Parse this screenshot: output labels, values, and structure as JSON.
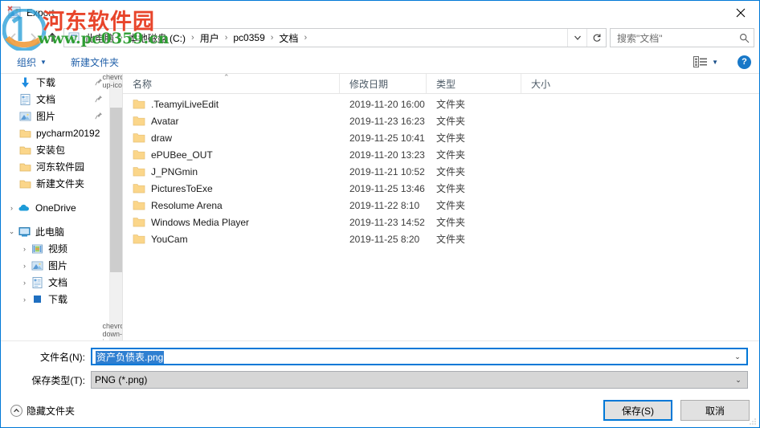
{
  "window": {
    "title": "Export",
    "title_icon": "export-image-icon",
    "close_label": "✕"
  },
  "navigation": {
    "back_icon": "arrow-left-icon",
    "forward_icon": "arrow-right-icon",
    "up_icon": "arrow-up-icon",
    "refresh_icon": "refresh-icon",
    "dropdown_icon": "chevron-down-icon",
    "breadcrumb": [
      {
        "label": "此电脑",
        "icon": "this-pc-icon"
      },
      {
        "label": "本地磁盘 (C:)",
        "icon": ""
      },
      {
        "label": "用户",
        "icon": ""
      },
      {
        "label": "pc0359",
        "icon": ""
      },
      {
        "label": "文档",
        "icon": ""
      }
    ],
    "separator": "›"
  },
  "search": {
    "placeholder": "搜索\"文档\"",
    "icon": "search-icon"
  },
  "toolbar": {
    "organize_label": "组织",
    "organize_caret": "▼",
    "new_folder_label": "新建文件夹",
    "view_icon": "view-layout-icon",
    "view_caret": "▼",
    "help_label": "?",
    "help_icon": "help-icon"
  },
  "sidebar": {
    "items": [
      {
        "label": "下载",
        "icon": "download-icon",
        "indent": 1,
        "expander": "",
        "pinned": true
      },
      {
        "label": "文档",
        "icon": "documents-icon",
        "indent": 1,
        "expander": "",
        "pinned": true
      },
      {
        "label": "图片",
        "icon": "pictures-icon",
        "indent": 1,
        "expander": "",
        "pinned": true
      },
      {
        "label": "pycharm20192",
        "icon": "folder-icon",
        "indent": 1,
        "expander": "",
        "pinned": false
      },
      {
        "label": "安装包",
        "icon": "folder-icon",
        "indent": 1,
        "expander": "",
        "pinned": false
      },
      {
        "label": "河东软件园",
        "icon": "folder-icon",
        "indent": 1,
        "expander": "",
        "pinned": false
      },
      {
        "label": "新建文件夹",
        "icon": "folder-icon",
        "indent": 1,
        "expander": "",
        "pinned": false
      },
      {
        "label": "OneDrive",
        "icon": "onedrive-icon",
        "indent": 1,
        "expander": "›",
        "pinned": false,
        "gap_before": true
      },
      {
        "label": "此电脑",
        "icon": "this-pc-icon",
        "indent": 1,
        "expander": "⌄",
        "pinned": false,
        "gap_before": true
      },
      {
        "label": "视频",
        "icon": "videos-icon",
        "indent": 2,
        "expander": "›",
        "pinned": false
      },
      {
        "label": "图片",
        "icon": "pictures-icon",
        "indent": 2,
        "expander": "›",
        "pinned": false
      },
      {
        "label": "文档",
        "icon": "documents-icon",
        "indent": 2,
        "expander": "›",
        "pinned": false
      },
      {
        "label": "下载",
        "icon": "download-blue-icon",
        "indent": 2,
        "expander": "›",
        "pinned": false
      }
    ],
    "scroll_up_icon": "chevron-up-icon",
    "scroll_down_icon": "chevron-down-icon",
    "pin_icon": "pin-icon"
  },
  "filelist": {
    "columns": [
      {
        "label": "名称",
        "sorted": true,
        "sort_caret": "⌃"
      },
      {
        "label": "修改日期",
        "sorted": false,
        "sort_caret": ""
      },
      {
        "label": "类型",
        "sorted": false,
        "sort_caret": ""
      },
      {
        "label": "大小",
        "sorted": false,
        "sort_caret": ""
      }
    ],
    "rows": [
      {
        "name": ".TeamyiLiveEdit",
        "modified": "2019-11-20 16:00",
        "type": "文件夹",
        "size": ""
      },
      {
        "name": "Avatar",
        "modified": "2019-11-23 16:23",
        "type": "文件夹",
        "size": ""
      },
      {
        "name": "draw",
        "modified": "2019-11-25 10:41",
        "type": "文件夹",
        "size": ""
      },
      {
        "name": "ePUBee_OUT",
        "modified": "2019-11-20 13:23",
        "type": "文件夹",
        "size": ""
      },
      {
        "name": "J_PNGmin",
        "modified": "2019-11-21 10:52",
        "type": "文件夹",
        "size": ""
      },
      {
        "name": "PicturesToExe",
        "modified": "2019-11-25 13:46",
        "type": "文件夹",
        "size": ""
      },
      {
        "name": "Resolume Arena",
        "modified": "2019-11-22 8:10",
        "type": "文件夹",
        "size": ""
      },
      {
        "name": "Windows Media Player",
        "modified": "2019-11-23 14:52",
        "type": "文件夹",
        "size": ""
      },
      {
        "name": "YouCam",
        "modified": "2019-11-25 8:20",
        "type": "文件夹",
        "size": ""
      }
    ],
    "row_icon": "folder-icon"
  },
  "fields": {
    "filename": {
      "label": "文件名(N):",
      "value": "资产负债表.png",
      "selected": true,
      "arrow": "⌄"
    },
    "filetype": {
      "label": "保存类型(T):",
      "value": "PNG (*.png)",
      "arrow": "⌄"
    }
  },
  "footer": {
    "hide_folders_label": "隐藏文件夹",
    "hide_folders_icon": "chevron-up-circle-icon",
    "save_label": "保存(S)",
    "cancel_label": "取消"
  },
  "watermark": {
    "line1": "河东软件园",
    "line2": "www.pc0359.cn",
    "logo_icon": "hedong-logo-icon"
  },
  "colors": {
    "accent": "#0078d7",
    "selection": "#2f7fd1",
    "link": "#1f5fa9",
    "folder": "#fbd68a",
    "watermark_red": "#e8452b",
    "watermark_green": "#2f9e34"
  }
}
